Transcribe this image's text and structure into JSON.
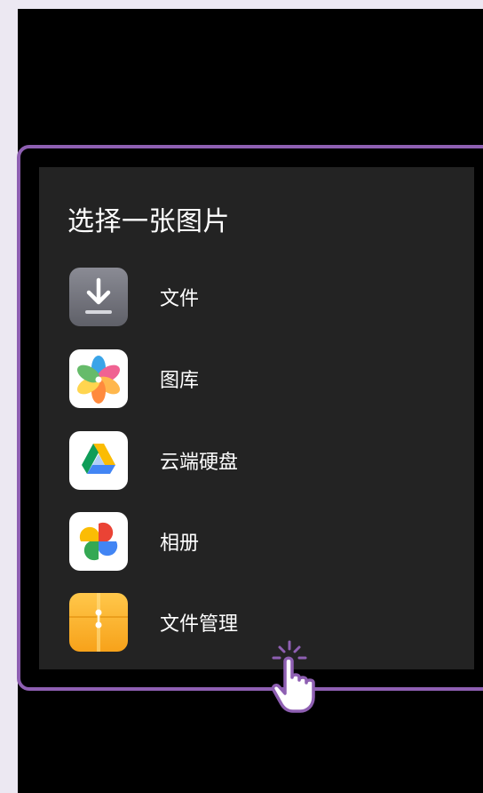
{
  "dialog": {
    "title": "选择一张图片",
    "options": [
      {
        "label": "文件",
        "icon": "download-arrow-icon"
      },
      {
        "label": "图库",
        "icon": "gallery-flower-icon"
      },
      {
        "label": "云端硬盘",
        "icon": "drive-triangle-icon"
      },
      {
        "label": "相册",
        "icon": "pinwheel-photos-icon"
      },
      {
        "label": "文件管理",
        "icon": "folder-zip-icon"
      }
    ]
  },
  "colors": {
    "highlight": "#8e5fb2",
    "dialog_background": "#232323",
    "screen_background": "#000000",
    "page_background": "#ece8f2"
  }
}
